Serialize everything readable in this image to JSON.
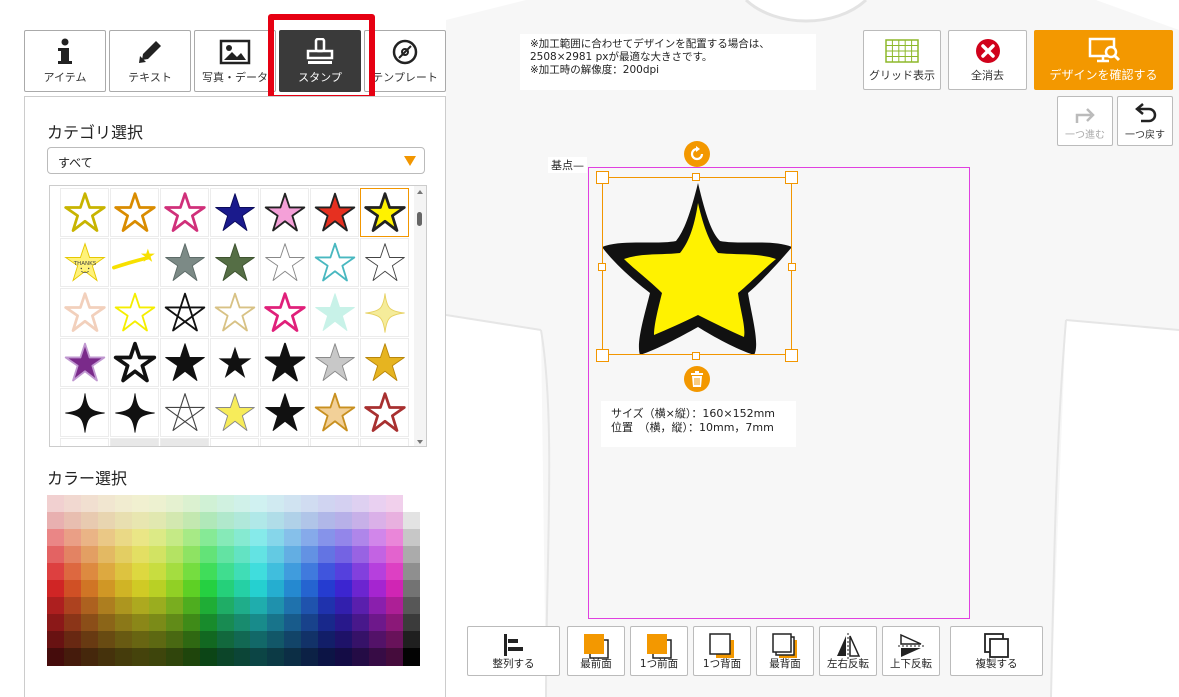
{
  "tool_tabs": [
    {
      "label": "アイテム",
      "icon": "info-icon"
    },
    {
      "label": "テキスト",
      "icon": "pen-icon"
    },
    {
      "label": "写真・データ",
      "icon": "image-icon"
    },
    {
      "label": "スタンプ",
      "icon": "stamp-icon",
      "active": true
    },
    {
      "label": "テンプレート",
      "icon": "disc-icon"
    }
  ],
  "panel": {
    "category_title": "カテゴリ選択",
    "category_selected": "すべて",
    "color_title": "カラー選択"
  },
  "info_note": {
    "line1": "※加工範囲に合わせてデザインを配置する場合は、",
    "line2": "2508×2981 pxが最適な大きさです。",
    "line3": "※加工時の解像度：200dpi"
  },
  "top_buttons": {
    "grid": "グリッド表示",
    "clear": "全消去",
    "confirm": "デザインを確認する"
  },
  "undo": {
    "redo": "一つ進む",
    "undo": "一つ戻す"
  },
  "canvas": {
    "origin_label": "基点",
    "size_line": "サイズ（横×縦）：160×152mm",
    "position_line": "位置　（横，縦）：10mm，7mm"
  },
  "bottom_buttons": {
    "align": "整列する",
    "front": "最前面",
    "forward": "1つ前面",
    "backward": "1つ背面",
    "back": "最背面",
    "flip_h": "左右反転",
    "flip_v": "上下反転",
    "duplicate": "複製する"
  },
  "colors": {
    "accent": "#f39800",
    "highlight": "#e60012",
    "tab_active": "#3a3a3a",
    "print_area": "#e040e0",
    "star_fill": "#fff200",
    "delete_red": "#d0021b"
  }
}
